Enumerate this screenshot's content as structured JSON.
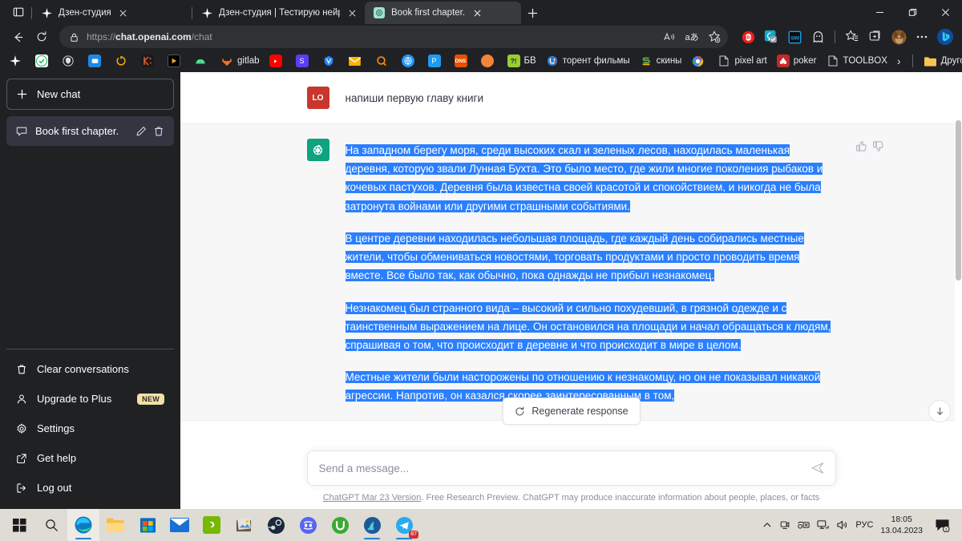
{
  "browser": {
    "tabs": [
      {
        "title": "Дзен-студия",
        "favicon": "sparkle-icon",
        "active": false
      },
      {
        "title": "Дзен-студия | Тестирую нейрос",
        "favicon": "sparkle-icon",
        "active": false
      },
      {
        "title": "Book first chapter.",
        "favicon": "chatgpt-icon",
        "active": true
      }
    ],
    "new_tab_label": "+",
    "window_controls": {
      "minimize": "—",
      "maximize": "❐",
      "close": "✕"
    },
    "nav": {
      "back": "back-arrow-icon",
      "reload": "reload-icon"
    },
    "address": {
      "lock": "lock-icon",
      "scheme": "https://",
      "host": "chat.openai.com",
      "path": "/chat",
      "full": "https://chat.openai.com/chat"
    },
    "omnibox_actions": [
      "read-aloud-icon",
      "translate-icon",
      "add-favorite-icon"
    ],
    "toolbar_extensions": [
      "adblock-icon",
      "vpn-extension-icon",
      "sim-extension-icon",
      "ghost-extension-icon"
    ],
    "toolbar_right": [
      "favorites-icon",
      "collections-icon",
      "profile-avatar",
      "settings-more-icon",
      "bing-copilot-icon"
    ],
    "bookmarks": [
      {
        "label": "",
        "icon": "sparkle-icon",
        "color": "#000000"
      },
      {
        "label": "",
        "icon": "green-check-icon",
        "color": "#1db954"
      },
      {
        "label": "",
        "icon": "shield-icon",
        "color": "#8a8a8a"
      },
      {
        "label": "",
        "icon": "chat-bubble-icon",
        "color": "#1e88e5"
      },
      {
        "label": "",
        "icon": "timer-icon",
        "color": "#f2a900"
      },
      {
        "label": "",
        "icon": "kodi-icon",
        "color": "#cc3b1f"
      },
      {
        "label": "",
        "icon": "play-icon",
        "color": "#111111"
      },
      {
        "label": "",
        "icon": "android-icon",
        "color": "#3ddc84"
      },
      {
        "label": "gitlab",
        "icon": "gitlab-icon",
        "color": "#fc6d26"
      },
      {
        "label": "",
        "icon": "youtube-icon",
        "color": "#ff0000"
      },
      {
        "label": "",
        "icon": "s-letter-icon",
        "color": "#5b3df5"
      },
      {
        "label": "",
        "icon": "vk-video-icon",
        "color": "#2787f5"
      },
      {
        "label": "",
        "icon": "mail-icon",
        "color": "#ffb300"
      },
      {
        "label": "",
        "icon": "q-letter-icon",
        "color": "#ff8c00"
      },
      {
        "label": "",
        "icon": "globe-icon",
        "color": "#2196f3"
      },
      {
        "label": "",
        "icon": "p-letter-icon",
        "color": "#1e9bf0"
      },
      {
        "label": "",
        "icon": "dns-icon",
        "color": "#e65100"
      },
      {
        "label": "",
        "icon": "orange-circle-icon",
        "color": "#f4833b"
      },
      {
        "label": "БВ",
        "icon": "exclaim-icon",
        "color": "#8bc34a"
      },
      {
        "label": "торент фильмы",
        "icon": "utorrent-icon",
        "color": "#2b7cd3"
      },
      {
        "label": "скины",
        "icon": "s-green-icon",
        "color": "#6aa84f"
      },
      {
        "label": "",
        "icon": "chrome-icon",
        "color": "#4285f4"
      },
      {
        "label": "pixel art",
        "icon": "page-icon",
        "color": "#b0b0b0"
      },
      {
        "label": "poker",
        "icon": "poker-icon",
        "color": "#c62828"
      },
      {
        "label": "TOOLBOX",
        "icon": "page-icon",
        "color": "#b0b0b0"
      }
    ],
    "bookmarks_overflow": "›",
    "other_favorites": {
      "label": "Другое избранное",
      "icon": "folder-icon"
    }
  },
  "sidebar": {
    "new_chat": {
      "label": "New chat",
      "icon": "plus-icon"
    },
    "conversations": [
      {
        "title": "Book first chapter.",
        "icon": "chat-bubble-icon",
        "edit": "pencil-icon",
        "delete": "trash-icon",
        "active": true
      }
    ],
    "menu": [
      {
        "label": "Clear conversations",
        "icon": "trash-icon",
        "badge": null
      },
      {
        "label": "Upgrade to Plus",
        "icon": "user-icon",
        "badge": "NEW"
      },
      {
        "label": "Settings",
        "icon": "gear-icon",
        "badge": null
      },
      {
        "label": "Get help",
        "icon": "external-link-icon",
        "badge": null
      },
      {
        "label": "Log out",
        "icon": "logout-icon",
        "badge": null
      }
    ]
  },
  "chat": {
    "messages": [
      {
        "role": "user",
        "avatar_label": "LO",
        "avatar_color": "#c8372d",
        "text": "напиши первую главу книги"
      },
      {
        "role": "assistant",
        "avatar_label": "chatgpt-logo",
        "avatar_color": "#10a37f",
        "paragraphs": [
          "На западном берегу моря, среди высоких скал и зеленых лесов, находилась маленькая деревня, которую звали Лунная Бухта. Это было место, где жили многие поколения рыбаков и кочевых пастухов. Деревня была известна своей красотой и спокойствием, и никогда не была затронута войнами или другими страшными событиями.",
          "В центре деревни находилась небольшая площадь, где каждый день собирались местные жители, чтобы обмениваться новостями, торговать продуктами и просто проводить время вместе. Все было так, как обычно, пока однажды не прибыл незнакомец.",
          "Незнакомец был странного вида – высокий и сильно похудевший, в грязной одежде и с таинственным выражением на лице. Он остановился на площади и начал обращаться к людям, спрашивая о том, что происходит в деревне и что происходит в мире в целом.",
          "Местные жители были насторожены по отношению к незнакомцу, но он не показывал никакой агрессии. Напротив, он казался скорее заинтересованным в том,"
        ],
        "actions": {
          "thumbs_up": "thumbs-up-icon",
          "thumbs_down": "thumbs-down-icon"
        }
      }
    ],
    "regenerate": {
      "label": "Regenerate response",
      "icon": "refresh-icon"
    },
    "scroll_to_bottom": {
      "icon": "arrow-down-icon"
    },
    "composer": {
      "placeholder": "Send a message...",
      "send_icon": "send-icon",
      "value": ""
    },
    "footnote": {
      "link": "ChatGPT Mar 23 Version",
      "rest": ". Free Research Preview. ChatGPT may produce inaccurate information about people, places, or facts"
    },
    "selection_color": "#2a7fff"
  },
  "taskbar": {
    "start": "windows-start-icon",
    "search": "search-icon",
    "apps": [
      {
        "name": "edge-icon",
        "active": true
      },
      {
        "name": "file-explorer-icon",
        "active": false
      },
      {
        "name": "microsoft-store-icon",
        "active": false
      },
      {
        "name": "mail-icon",
        "active": false
      },
      {
        "name": "nvidia-icon",
        "active": false
      },
      {
        "name": "photo-viewer-icon",
        "active": false
      },
      {
        "name": "steam-icon",
        "active": false
      },
      {
        "name": "discord-icon",
        "active": false
      },
      {
        "name": "utorrent-icon",
        "active": false
      },
      {
        "name": "ammyy-icon",
        "active": true
      },
      {
        "name": "telegram-icon",
        "active": true,
        "badge": "87"
      }
    ],
    "tray": {
      "chevron": "show-hidden-icons-icon",
      "icons": [
        "webcam-icon",
        "keyboard-icon",
        "network-icon",
        "volume-icon"
      ],
      "language": "РУС",
      "time": "18:05",
      "date": "13.04.2023",
      "notifications": {
        "icon": "notification-icon",
        "count": "1"
      }
    }
  }
}
